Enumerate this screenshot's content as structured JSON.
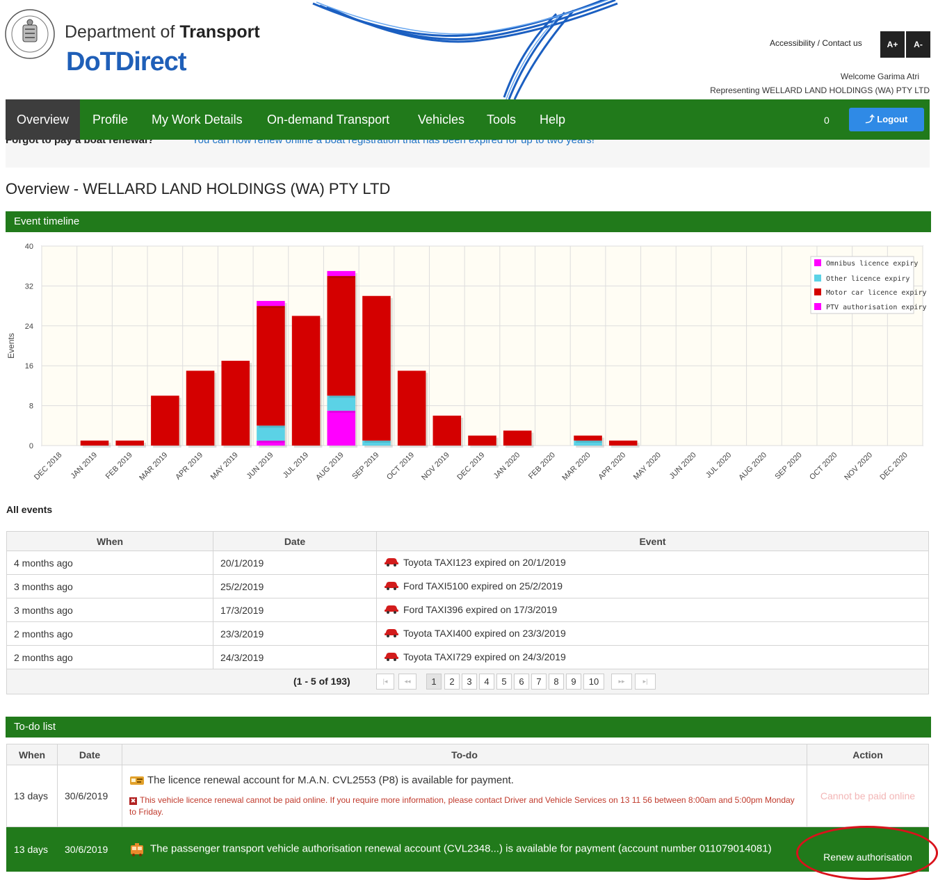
{
  "header": {
    "dept_prefix": "Department of",
    "dept_bold": "Transport",
    "logo_text": "DoTDirect",
    "accessibility_link": "Accessibility / Contact us",
    "font_increase": "A+",
    "font_decrease": "A-",
    "welcome": "Welcome Garima Atri",
    "representing": "Representing WELLARD LAND HOLDINGS (WA) PTY LTD"
  },
  "nav": {
    "items": [
      "Overview",
      "Profile",
      "My Work Details",
      "On-demand Transport",
      "Vehicles",
      "Tools",
      "Help"
    ],
    "active": "Overview",
    "cart_count": "0",
    "logout_label": "Logout"
  },
  "notice": {
    "question": "Forgot to pay a boat renewal?",
    "answer": "You can now renew online a boat registration that has been expired for up to two years!"
  },
  "page_title": "Overview - WELLARD LAND HOLDINGS (WA) PTY LTD",
  "event_timeline": {
    "heading": "Event timeline"
  },
  "chart_data": {
    "type": "bar",
    "stacked": true,
    "ylabel": "Events",
    "ylim": [
      0,
      40
    ],
    "yticks": [
      0,
      8,
      16,
      24,
      32,
      40
    ],
    "grid": true,
    "legend_position": "top-right",
    "categories": [
      "DEC 2018",
      "JAN 2019",
      "FEB 2019",
      "MAR 2019",
      "APR 2019",
      "MAY 2019",
      "JUN 2019",
      "JUL 2019",
      "AUG 2019",
      "SEP 2019",
      "OCT 2019",
      "NOV 2019",
      "DEC 2019",
      "JAN 2020",
      "FEB 2020",
      "MAR 2020",
      "APR 2020",
      "MAY 2020",
      "JUN 2020",
      "JUL 2020",
      "AUG 2020",
      "SEP 2020",
      "OCT 2020",
      "NOV 2020",
      "DEC 2020"
    ],
    "series": [
      {
        "name": "PTV authorisation expiry",
        "color": "#ff00ff",
        "values": [
          0,
          0,
          0,
          0,
          0,
          0,
          1,
          0,
          7,
          0,
          0,
          0,
          0,
          0,
          0,
          0,
          0,
          0,
          0,
          0,
          0,
          0,
          0,
          0,
          0
        ]
      },
      {
        "name": "Other licence expiry",
        "color": "#5bd2e6",
        "values": [
          0,
          0,
          0,
          0,
          0,
          0,
          3,
          0,
          3,
          1,
          0,
          0,
          0,
          0,
          0,
          1,
          0,
          0,
          0,
          0,
          0,
          0,
          0,
          0,
          0
        ]
      },
      {
        "name": "Motor car licence expiry",
        "color": "#d40000",
        "values": [
          0,
          1,
          1,
          10,
          15,
          17,
          24,
          26,
          24,
          29,
          15,
          6,
          2,
          3,
          0,
          1,
          1,
          0,
          0,
          0,
          0,
          0,
          0,
          0,
          0
        ]
      },
      {
        "name": "Omnibus licence expiry",
        "color": "#ff00ff",
        "values": [
          0,
          0,
          0,
          0,
          0,
          0,
          1,
          0,
          1,
          0,
          0,
          0,
          0,
          0,
          0,
          0,
          0,
          0,
          0,
          0,
          0,
          0,
          0,
          0,
          0
        ]
      }
    ],
    "legend_order": [
      "Omnibus licence expiry",
      "Other licence expiry",
      "Motor car licence expiry",
      "PTV authorisation expiry"
    ]
  },
  "all_events": {
    "heading": "All events",
    "columns": [
      "When",
      "Date",
      "Event"
    ],
    "rows": [
      {
        "when": "4 months ago",
        "date": "20/1/2019",
        "event": "Toyota TAXI123 expired on 20/1/2019"
      },
      {
        "when": "3 months ago",
        "date": "25/2/2019",
        "event": "Ford TAXI5100 expired on 25/2/2019"
      },
      {
        "when": "3 months ago",
        "date": "17/3/2019",
        "event": "Ford TAXI396 expired on 17/3/2019"
      },
      {
        "when": "2 months ago",
        "date": "23/3/2019",
        "event": "Toyota TAXI400 expired on 23/3/2019"
      },
      {
        "when": "2 months ago",
        "date": "24/3/2019",
        "event": "Toyota TAXI729 expired on 24/3/2019"
      }
    ],
    "pager_summary": "(1 - 5 of 193)",
    "pages": [
      "1",
      "2",
      "3",
      "4",
      "5",
      "6",
      "7",
      "8",
      "9",
      "10"
    ],
    "current_page": "1",
    "first_label": "|◂",
    "prev_label": "◂◂",
    "next_label": "▸▸",
    "last_label": "▸|"
  },
  "todo": {
    "heading": "To-do list",
    "columns": [
      "When",
      "Date",
      "To-do",
      "Action"
    ],
    "row1": {
      "when": "13 days",
      "date": "30/6/2019",
      "text": "The licence renewal account for M.A.N. CVL2553 (P8) is available for payment.",
      "error": "This vehicle licence renewal cannot be paid online. If you require more information, please contact Driver and Vehicle Services on 13 11 56 between 8:00am and 5:00pm Monday to Friday.",
      "action": "Cannot be paid online"
    },
    "row2": {
      "when": "13 days",
      "date": "30/6/2019",
      "text": "The passenger transport vehicle authorisation renewal account (CVL2348...) is available for payment (account number 011079014081)",
      "action": "Renew authorisation"
    }
  }
}
